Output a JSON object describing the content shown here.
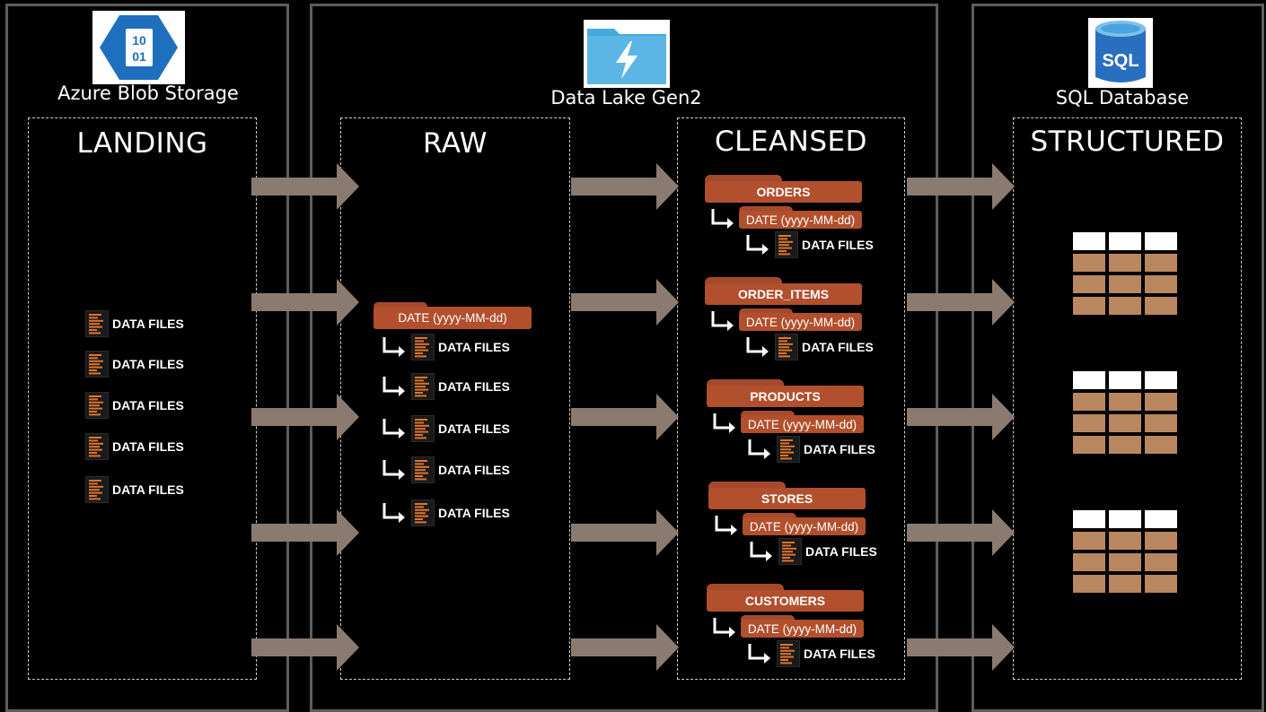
{
  "services": {
    "blob": {
      "label": "Azure Blob Storage",
      "logo_text_top": "10",
      "logo_text_bottom": "01"
    },
    "lake": {
      "label": "Data Lake Gen2"
    },
    "sql": {
      "label": "SQL Database",
      "logo_text": "SQL"
    }
  },
  "zones": {
    "landing": {
      "title": "LANDING",
      "files": [
        "DATA FILES",
        "DATA FILES",
        "DATA FILES",
        "DATA FILES",
        "DATA FILES"
      ]
    },
    "raw": {
      "title": "RAW",
      "date_folder": "DATE (yyyy-MM-dd)",
      "files": [
        "DATA FILES",
        "DATA FILES",
        "DATA FILES",
        "DATA FILES",
        "DATA FILES"
      ]
    },
    "cleansed": {
      "title": "CLEANSED",
      "groups": [
        {
          "name": "ORDERS",
          "date_folder": "DATE (yyyy-MM-dd)",
          "file": "DATA FILES"
        },
        {
          "name": "ORDER_ITEMS",
          "date_folder": "DATE (yyyy-MM-dd)",
          "file": "DATA FILES"
        },
        {
          "name": "PRODUCTS",
          "date_folder": "DATE (yyyy-MM-dd)",
          "file": "DATA FILES"
        },
        {
          "name": "STORES",
          "date_folder": "DATE (yyyy-MM-dd)",
          "file": "DATA FILES"
        },
        {
          "name": "CUSTOMERS",
          "date_folder": "DATE (yyyy-MM-dd)",
          "file": "DATA FILES"
        }
      ]
    },
    "structured": {
      "title": "STRUCTURED"
    }
  },
  "colors": {
    "folder": "#b24f2c",
    "arrow": "#8a7a70",
    "table_header": "#ffffff",
    "table_cell": "#b9875f",
    "blob_logo": "#1f6fbf",
    "lake_logo": "#46a9e0",
    "sql_logo": "#2a6fbf"
  }
}
